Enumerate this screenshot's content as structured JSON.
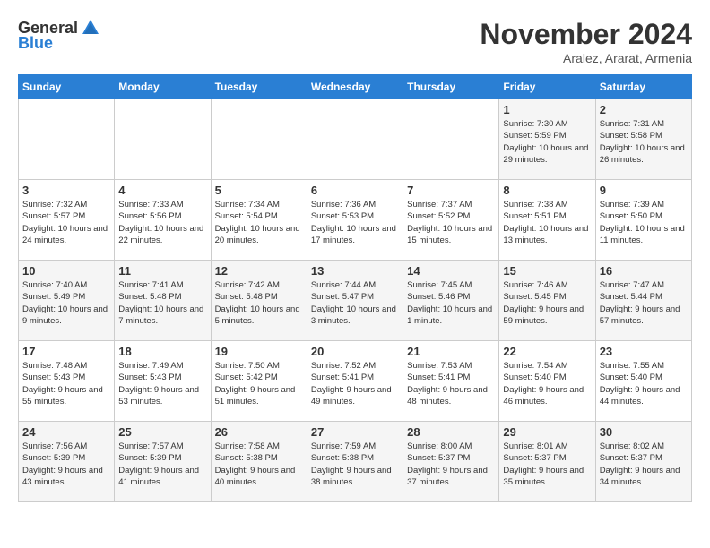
{
  "logo": {
    "general": "General",
    "blue": "Blue"
  },
  "title": "November 2024",
  "location": "Aralez, Ararat, Armenia",
  "days_header": [
    "Sunday",
    "Monday",
    "Tuesday",
    "Wednesday",
    "Thursday",
    "Friday",
    "Saturday"
  ],
  "weeks": [
    [
      {
        "day": "",
        "info": ""
      },
      {
        "day": "",
        "info": ""
      },
      {
        "day": "",
        "info": ""
      },
      {
        "day": "",
        "info": ""
      },
      {
        "day": "",
        "info": ""
      },
      {
        "day": "1",
        "info": "Sunrise: 7:30 AM\nSunset: 5:59 PM\nDaylight: 10 hours and 29 minutes."
      },
      {
        "day": "2",
        "info": "Sunrise: 7:31 AM\nSunset: 5:58 PM\nDaylight: 10 hours and 26 minutes."
      }
    ],
    [
      {
        "day": "3",
        "info": "Sunrise: 7:32 AM\nSunset: 5:57 PM\nDaylight: 10 hours and 24 minutes."
      },
      {
        "day": "4",
        "info": "Sunrise: 7:33 AM\nSunset: 5:56 PM\nDaylight: 10 hours and 22 minutes."
      },
      {
        "day": "5",
        "info": "Sunrise: 7:34 AM\nSunset: 5:54 PM\nDaylight: 10 hours and 20 minutes."
      },
      {
        "day": "6",
        "info": "Sunrise: 7:36 AM\nSunset: 5:53 PM\nDaylight: 10 hours and 17 minutes."
      },
      {
        "day": "7",
        "info": "Sunrise: 7:37 AM\nSunset: 5:52 PM\nDaylight: 10 hours and 15 minutes."
      },
      {
        "day": "8",
        "info": "Sunrise: 7:38 AM\nSunset: 5:51 PM\nDaylight: 10 hours and 13 minutes."
      },
      {
        "day": "9",
        "info": "Sunrise: 7:39 AM\nSunset: 5:50 PM\nDaylight: 10 hours and 11 minutes."
      }
    ],
    [
      {
        "day": "10",
        "info": "Sunrise: 7:40 AM\nSunset: 5:49 PM\nDaylight: 10 hours and 9 minutes."
      },
      {
        "day": "11",
        "info": "Sunrise: 7:41 AM\nSunset: 5:48 PM\nDaylight: 10 hours and 7 minutes."
      },
      {
        "day": "12",
        "info": "Sunrise: 7:42 AM\nSunset: 5:48 PM\nDaylight: 10 hours and 5 minutes."
      },
      {
        "day": "13",
        "info": "Sunrise: 7:44 AM\nSunset: 5:47 PM\nDaylight: 10 hours and 3 minutes."
      },
      {
        "day": "14",
        "info": "Sunrise: 7:45 AM\nSunset: 5:46 PM\nDaylight: 10 hours and 1 minute."
      },
      {
        "day": "15",
        "info": "Sunrise: 7:46 AM\nSunset: 5:45 PM\nDaylight: 9 hours and 59 minutes."
      },
      {
        "day": "16",
        "info": "Sunrise: 7:47 AM\nSunset: 5:44 PM\nDaylight: 9 hours and 57 minutes."
      }
    ],
    [
      {
        "day": "17",
        "info": "Sunrise: 7:48 AM\nSunset: 5:43 PM\nDaylight: 9 hours and 55 minutes."
      },
      {
        "day": "18",
        "info": "Sunrise: 7:49 AM\nSunset: 5:43 PM\nDaylight: 9 hours and 53 minutes."
      },
      {
        "day": "19",
        "info": "Sunrise: 7:50 AM\nSunset: 5:42 PM\nDaylight: 9 hours and 51 minutes."
      },
      {
        "day": "20",
        "info": "Sunrise: 7:52 AM\nSunset: 5:41 PM\nDaylight: 9 hours and 49 minutes."
      },
      {
        "day": "21",
        "info": "Sunrise: 7:53 AM\nSunset: 5:41 PM\nDaylight: 9 hours and 48 minutes."
      },
      {
        "day": "22",
        "info": "Sunrise: 7:54 AM\nSunset: 5:40 PM\nDaylight: 9 hours and 46 minutes."
      },
      {
        "day": "23",
        "info": "Sunrise: 7:55 AM\nSunset: 5:40 PM\nDaylight: 9 hours and 44 minutes."
      }
    ],
    [
      {
        "day": "24",
        "info": "Sunrise: 7:56 AM\nSunset: 5:39 PM\nDaylight: 9 hours and 43 minutes."
      },
      {
        "day": "25",
        "info": "Sunrise: 7:57 AM\nSunset: 5:39 PM\nDaylight: 9 hours and 41 minutes."
      },
      {
        "day": "26",
        "info": "Sunrise: 7:58 AM\nSunset: 5:38 PM\nDaylight: 9 hours and 40 minutes."
      },
      {
        "day": "27",
        "info": "Sunrise: 7:59 AM\nSunset: 5:38 PM\nDaylight: 9 hours and 38 minutes."
      },
      {
        "day": "28",
        "info": "Sunrise: 8:00 AM\nSunset: 5:37 PM\nDaylight: 9 hours and 37 minutes."
      },
      {
        "day": "29",
        "info": "Sunrise: 8:01 AM\nSunset: 5:37 PM\nDaylight: 9 hours and 35 minutes."
      },
      {
        "day": "30",
        "info": "Sunrise: 8:02 AM\nSunset: 5:37 PM\nDaylight: 9 hours and 34 minutes."
      }
    ]
  ]
}
